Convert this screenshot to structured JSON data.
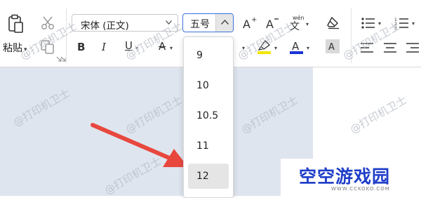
{
  "toolbar": {
    "paste_label": "粘贴",
    "font_name": "宋体 (正文)",
    "font_size": "五号"
  },
  "font_size_dropdown": {
    "options": [
      "9",
      "10",
      "10.5",
      "11",
      "12"
    ],
    "highlighted": "12"
  },
  "watermark_text": "@打印机卫士",
  "logo": {
    "title": "空空游戏园",
    "url": "WWW.CCKOKO.COM"
  },
  "colors": {
    "accent_border": "#3a6fd8",
    "highlight_yellow": "#f2e600",
    "font_color_blue": "#1a33d6",
    "arrow_red": "#e8473e",
    "logo_blue": "#1f3ec9",
    "doc_backdrop": "#dfe5ee"
  }
}
